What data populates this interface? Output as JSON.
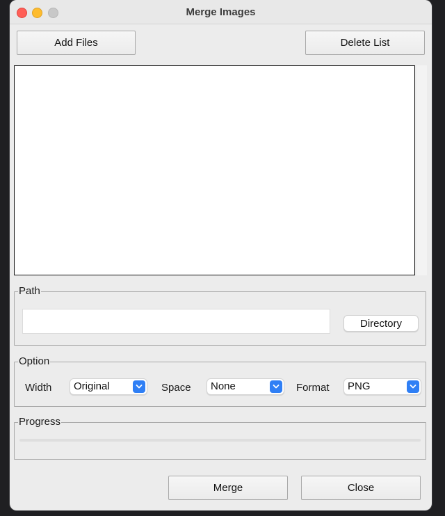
{
  "window": {
    "title": "Merge Images"
  },
  "toolbar": {
    "add_files_label": "Add Files",
    "delete_list_label": "Delete List"
  },
  "file_list": {
    "items": []
  },
  "path_group": {
    "legend": "Path",
    "path_value": "",
    "directory_label": "Directory"
  },
  "option_group": {
    "legend": "Option",
    "width_label": "Width",
    "width_value": "Original",
    "space_label": "Space",
    "space_value": "None",
    "format_label": "Format",
    "format_value": "PNG"
  },
  "progress_group": {
    "legend": "Progress",
    "progress_fraction": 0
  },
  "footer": {
    "merge_label": "Merge",
    "close_label": "Close"
  },
  "colors": {
    "accent": "#2f7ff5",
    "close": "#ff5f57",
    "minimize": "#febc2e",
    "zoom": "#c8c8c8"
  },
  "icons": [
    "chevron-down-icon"
  ]
}
